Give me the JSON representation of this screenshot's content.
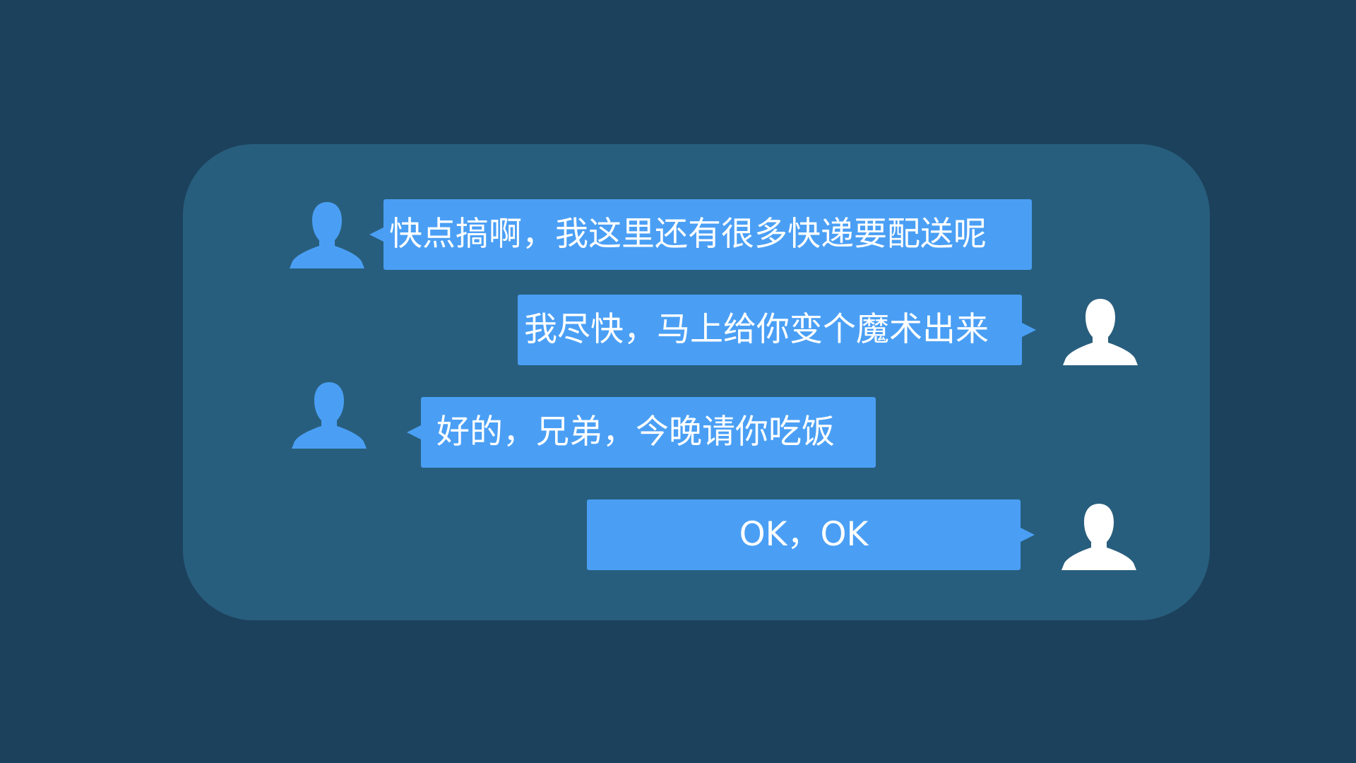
{
  "colors": {
    "background": "#1c415c",
    "panel": "#285e7d",
    "bubble": "#4a9ff5",
    "avatar_left": "#4a9ff5",
    "avatar_right": "#ffffff",
    "text": "#ffffff"
  },
  "messages": [
    {
      "side": "left",
      "avatar_icon": "person-silhouette-icon",
      "text": "快点搞啊，我这里还有很多快递要配送呢"
    },
    {
      "side": "right",
      "avatar_icon": "person-silhouette-icon",
      "text": "我尽快，马上给你变个魔术出来"
    },
    {
      "side": "left",
      "avatar_icon": "person-silhouette-icon",
      "text": "好的，兄弟，今晚请你吃饭"
    },
    {
      "side": "right",
      "avatar_icon": "person-silhouette-icon",
      "text": "OK，OK"
    }
  ]
}
